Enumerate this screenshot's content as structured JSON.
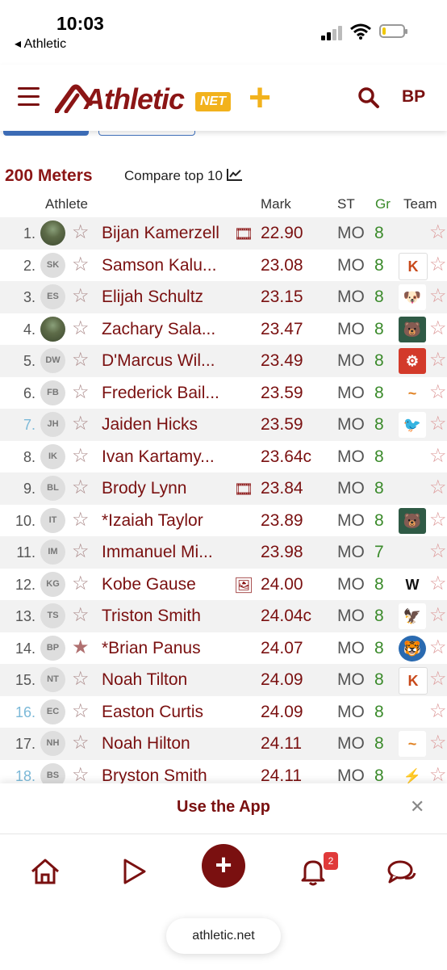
{
  "status": {
    "time": "10:03",
    "back_label": "◂ Athletic"
  },
  "header": {
    "logo_text": "Athletic",
    "logo_net": "NET",
    "logo_plus": "+",
    "user_initials": "BP"
  },
  "event": {
    "title": "200 Meters",
    "compare_label": "Compare top 10"
  },
  "columns": {
    "athlete": "Athlete",
    "mark": "Mark",
    "state": "ST",
    "grade": "Gr",
    "team": "Team"
  },
  "rows": [
    {
      "rank": "1.",
      "initials": "",
      "name": "Bijan Kamerzell",
      "media": "🎞",
      "mark": "22.90",
      "state": "MO",
      "grade": "8",
      "team": ""
    },
    {
      "rank": "2.",
      "initials": "SK",
      "name": "Samson Kalu...",
      "media": "",
      "mark": "23.08",
      "state": "MO",
      "grade": "8",
      "team": "K"
    },
    {
      "rank": "3.",
      "initials": "ES",
      "name": "Elijah Schultz",
      "media": "",
      "mark": "23.15",
      "state": "MO",
      "grade": "8",
      "team": "🐶"
    },
    {
      "rank": "4.",
      "initials": "",
      "name": "Zachary Sala...",
      "media": "",
      "mark": "23.47",
      "state": "MO",
      "grade": "8",
      "team": "🐻"
    },
    {
      "rank": "5.",
      "initials": "DW",
      "name": "D'Marcus Wil...",
      "media": "",
      "mark": "23.49",
      "state": "MO",
      "grade": "8",
      "team": "⚙"
    },
    {
      "rank": "6.",
      "initials": "FB",
      "name": "Frederick Bail...",
      "media": "",
      "mark": "23.59",
      "state": "MO",
      "grade": "8",
      "team": "~"
    },
    {
      "rank": "7.",
      "initials": "JH",
      "name": "Jaiden Hicks",
      "media": "",
      "mark": "23.59",
      "state": "MO",
      "grade": "8",
      "team": "🐦"
    },
    {
      "rank": "8.",
      "initials": "IK",
      "name": "Ivan Kartamy...",
      "media": "",
      "mark": "23.64c",
      "state": "MO",
      "grade": "8",
      "team": ""
    },
    {
      "rank": "9.",
      "initials": "BL",
      "name": "Brody Lynn",
      "media": "🎞",
      "mark": "23.84",
      "state": "MO",
      "grade": "8",
      "team": ""
    },
    {
      "rank": "10.",
      "initials": "IT",
      "name": "*Izaiah Taylor",
      "media": "",
      "mark": "23.89",
      "state": "MO",
      "grade": "8",
      "team": "🐻"
    },
    {
      "rank": "11.",
      "initials": "IM",
      "name": "Immanuel Mi...",
      "media": "",
      "mark": "23.98",
      "state": "MO",
      "grade": "7",
      "team": ""
    },
    {
      "rank": "12.",
      "initials": "KG",
      "name": "Kobe Gause",
      "media": "🖼",
      "mark": "24.00",
      "state": "MO",
      "grade": "8",
      "team": "W"
    },
    {
      "rank": "13.",
      "initials": "TS",
      "name": "Triston Smith",
      "media": "",
      "mark": "24.04c",
      "state": "MO",
      "grade": "8",
      "team": "🦅"
    },
    {
      "rank": "14.",
      "initials": "BP",
      "name": "*Brian Panus",
      "media": "",
      "mark": "24.07",
      "state": "MO",
      "grade": "8",
      "team": "🐯"
    },
    {
      "rank": "15.",
      "initials": "NT",
      "name": "Noah Tilton",
      "media": "",
      "mark": "24.09",
      "state": "MO",
      "grade": "8",
      "team": "K"
    },
    {
      "rank": "16.",
      "initials": "EC",
      "name": "Easton Curtis",
      "media": "",
      "mark": "24.09",
      "state": "MO",
      "grade": "8",
      "team": ""
    },
    {
      "rank": "17.",
      "initials": "NH",
      "name": "Noah Hilton",
      "media": "",
      "mark": "24.11",
      "state": "MO",
      "grade": "8",
      "team": "~"
    },
    {
      "rank": "18.",
      "initials": "BS",
      "name": "Bryston Smith",
      "media": "",
      "mark": "24.11",
      "state": "MO",
      "grade": "8",
      "team": "⚡"
    }
  ],
  "banner": {
    "text": "Use the App",
    "close": "✕"
  },
  "nav": {
    "plus": "+",
    "badge": "2",
    "url": "athletic.net"
  },
  "colors": {
    "brand": "#7a1010",
    "accent": "#f2b21c",
    "grade": "#3a8a2a"
  }
}
